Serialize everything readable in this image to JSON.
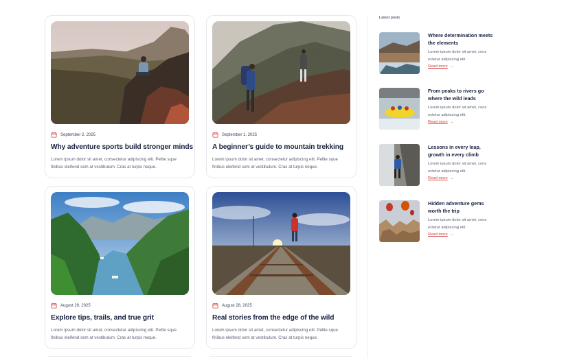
{
  "colors": {
    "accent": "#d14343",
    "title": "#18213f",
    "text": "#5a5e72",
    "border": "#e6e7ee"
  },
  "cards": [
    {
      "date": "September 2, 2025",
      "title": "Why adventure sports build stronger minds",
      "excerpt": "Lorem ipsum dolor sit amet, consectetur adipiscing elit. Pellte sque finibus eleifend sem at vestibulum. Cras at turpis neque."
    },
    {
      "date": "September 1, 2025",
      "title": "A beginner’s guide to mountain trekking",
      "excerpt": "Lorem ipsum dolor sit amet, consectetur adipiscing elit. Pellte sque finibus eleifend sem at vestibulum. Cras at turpis neque."
    },
    {
      "date": "August 29, 2025",
      "title": "Explore tips, trails, and true grit",
      "excerpt": "Lorem ipsum dolor sit amet, consectetur adipiscing elit. Pellte sque finibus eleifend sem at vestibulum. Cras at turpis neque."
    },
    {
      "date": "August 28, 2025",
      "title": "Real stories from the edge of the wild",
      "excerpt": "Lorem ipsum dolor sit amet, consectetur adipiscing elit. Pellte sque finibus eleifend sem at vestibulum. Cras at turpis neque."
    }
  ],
  "sidebar": {
    "heading": "Latest posts",
    "posts": [
      {
        "title": "Where determination meets the elements",
        "excerpt": "Lorem ipsum dolor sit amet, cons ectetur adipiscing elit.",
        "more": "Read more",
        "arrow": "→"
      },
      {
        "title": "From peaks to rivers go where the wild leads",
        "excerpt": "Lorem ipsum dolor sit amet, cons ectetur adipiscing elit.",
        "more": "Read more",
        "arrow": "→"
      },
      {
        "title": "Lessons in every leap, growth in every climb",
        "excerpt": "Lorem ipsum dolor sit amet, cons ectetur adipiscing elit.",
        "more": "Read more",
        "arrow": "→"
      },
      {
        "title": "Hidden adventure gems worth the trip",
        "excerpt": "Lorem ipsum dolor sit amet, cons ectetur adipiscing elit.",
        "more": "Read more",
        "arrow": "→"
      }
    ]
  }
}
